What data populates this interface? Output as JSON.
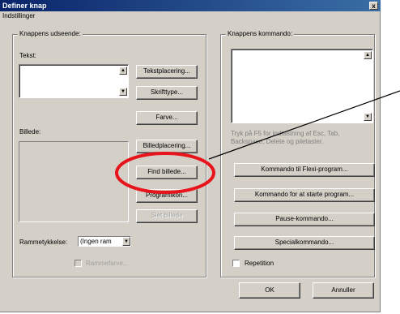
{
  "window": {
    "title": "Definer knap",
    "close_glyph": "x",
    "menu_label": "Indstillinger"
  },
  "appearance": {
    "group_title": "Knappens udseende:",
    "text_label": "Tekst:",
    "text_value": "",
    "image_label": "Billede:",
    "buttons": {
      "text_placement": "Tekstplacering...",
      "font_type": "Skrifttype...",
      "color": "Farve...",
      "image_placement": "Billedplacering...",
      "find_image": "Find billede...",
      "program_icon": "Programikon...",
      "delete_image": "Slet billede"
    },
    "frame_label": "Rammetykkelse:",
    "frame_value": "(Ingen ram",
    "checkbox_label": "Rammefarve..."
  },
  "command": {
    "group_title": "Knappens kommando:",
    "text_value": "",
    "hint": "Tryk på F5 for indtastning af Esc, Tab, Backspace, Delete og piletaster.",
    "buttons": {
      "flexi_command": "Kommando til Flexi-program...",
      "start_program": "Kommando for at starte program...",
      "pause_command": "Pause-kommando...",
      "special_command": "Specialkommando..."
    },
    "repeat_label": "Repetition"
  },
  "footer": {
    "ok": "OK",
    "cancel": "Annuller"
  },
  "icons": {
    "up": "▲",
    "down": "▼"
  },
  "annotation": {
    "color": "#e8141c"
  }
}
